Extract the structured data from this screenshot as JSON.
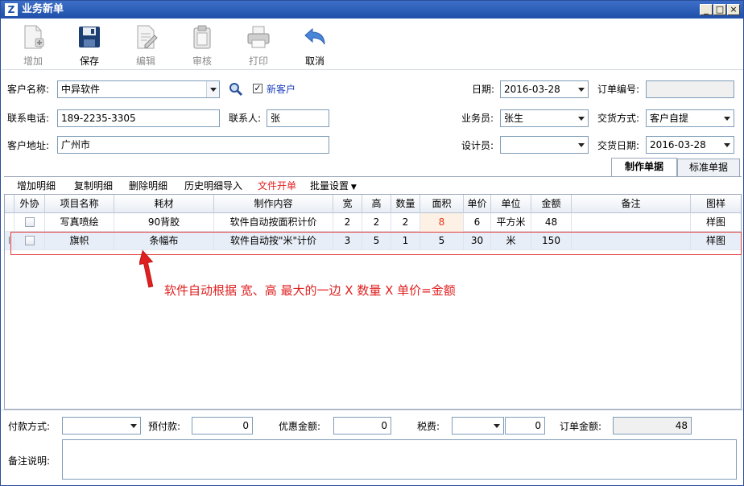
{
  "window": {
    "title": "业务新单"
  },
  "toolbar": [
    {
      "label": "增加",
      "enabled": false,
      "icon": "add-doc-icon"
    },
    {
      "label": "保存",
      "enabled": true,
      "icon": "floppy-icon"
    },
    {
      "label": "编辑",
      "enabled": false,
      "icon": "edit-icon"
    },
    {
      "label": "审核",
      "enabled": false,
      "icon": "clipboard-icon"
    },
    {
      "label": "打印",
      "enabled": false,
      "icon": "printer-icon"
    },
    {
      "label": "取消",
      "enabled": true,
      "icon": "undo-arrow-icon"
    }
  ],
  "form": {
    "customer_name_label": "客户名称:",
    "customer_name": "中异软件",
    "new_customer_label": "新客户",
    "new_customer_checked": true,
    "phone_label": "联系电话:",
    "phone": "189-2235-3305",
    "contact_label": "联系人:",
    "contact": "张",
    "address_label": "客户地址:",
    "address": "广州市",
    "date_label": "日期:",
    "date": "2016-03-28",
    "order_no_label": "订单编号:",
    "order_no": "",
    "salesman_label": "业务员:",
    "salesman": "张生",
    "delivery_method_label": "交货方式:",
    "delivery_method": "客户自提",
    "designer_label": "设计员:",
    "designer": "",
    "delivery_date_label": "交货日期:",
    "delivery_date": "2016-03-28"
  },
  "tabs": [
    {
      "label": "制作单据",
      "active": true
    },
    {
      "label": "标准单据",
      "active": false
    }
  ],
  "actions": {
    "add_detail": "增加明细",
    "copy_detail": "复制明细",
    "delete_detail": "删除明细",
    "import_history": "历史明细导入",
    "file_order": "文件开单",
    "batch_settings": "批量设置"
  },
  "grid": {
    "headers": [
      "外协",
      "项目名称",
      "耗材",
      "制作内容",
      "宽",
      "高",
      "数量",
      "面积",
      "单价",
      "单位",
      "金额",
      "备注",
      "图样"
    ],
    "rows": [
      {
        "outsource": false,
        "item": "写真喷绘",
        "material": "90背胶",
        "content": "软件自动按面积计价",
        "width": "2",
        "height": "2",
        "qty": "2",
        "area": "8",
        "price": "6",
        "unit": "平方米",
        "amount": "48",
        "remark": "",
        "pattern": "样图"
      },
      {
        "outsource": false,
        "item": "旗帜",
        "material": "条幅布",
        "content": "软件自动按\"米\"计价",
        "width": "3",
        "height": "5",
        "qty": "1",
        "area": "5",
        "price": "30",
        "unit": "米",
        "amount": "150",
        "remark": "",
        "pattern": "样图"
      }
    ]
  },
  "annotation": {
    "text": "软件自动根据 宽、高 最大的一边 X 数量 X 单价=金额",
    "color": "#e02020"
  },
  "footer": {
    "payment_method_label": "付款方式:",
    "payment_method": "",
    "prepaid_label": "预付款:",
    "prepaid": "0",
    "discount_label": "优惠金额:",
    "discount": "0",
    "tax_label": "税费:",
    "tax_type": "",
    "tax": "0",
    "order_amount_label": "订单金额:",
    "order_amount": "48",
    "remark_label": "备注说明:",
    "remark": ""
  },
  "colors": {
    "title_bar": "#1f4fa8",
    "accent_red": "#e23a3a",
    "link_blue": "#1a3fb8"
  }
}
